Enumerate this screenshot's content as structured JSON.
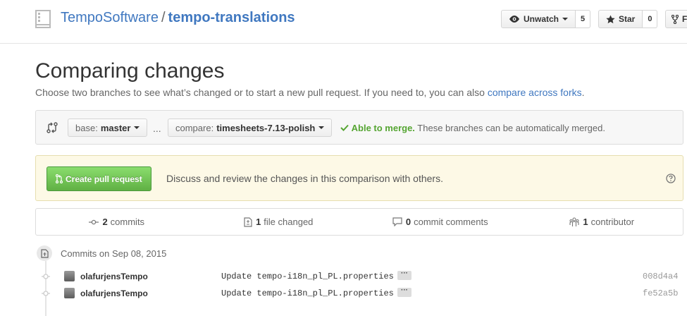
{
  "header": {
    "owner": "TempoSoftware",
    "separator": "/",
    "repo": "tempo-translations",
    "watch_label": "Unwatch",
    "watch_count": "5",
    "star_label": "Star",
    "star_count": "0",
    "fork_label": "F"
  },
  "page": {
    "title": "Comparing changes",
    "subtitle_text": "Choose two branches to see what’s changed or to start a new pull request. If you need to, you can also ",
    "subtitle_link": "compare across forks",
    "subtitle_end": "."
  },
  "range": {
    "base_prefix": "base:",
    "base_branch": "master",
    "dots": "...",
    "compare_prefix": "compare:",
    "compare_branch": "timesheets-7.13-polish",
    "merge_ok": "Able to merge.",
    "merge_text": " These branches can be automatically merged."
  },
  "compose": {
    "button_label": "Create pull request",
    "text": "Discuss and review the changes in this comparison with others."
  },
  "summary": {
    "commits_count": "2",
    "commits_label": "commits",
    "files_count": "1",
    "files_label": "file changed",
    "comments_count": "0",
    "comments_label": "commit comments",
    "contributors_count": "1",
    "contributors_label": "contributor"
  },
  "commit_group": {
    "title": "Commits on Sep 08, 2015"
  },
  "commits": [
    {
      "author": "olafurjensTempo",
      "message": "Update tempo-i18n_pl_PL.properties",
      "sha": "008d4a4"
    },
    {
      "author": "olafurjensTempo",
      "message": "Update tempo-i18n_pl_PL.properties",
      "sha": "fe52a5b"
    }
  ],
  "ellipsis_label": "···",
  "colors": {
    "link": "#4078c0",
    "success": "#55a532",
    "create_button": "#60b044",
    "compose_bg": "#fdf9e6"
  }
}
